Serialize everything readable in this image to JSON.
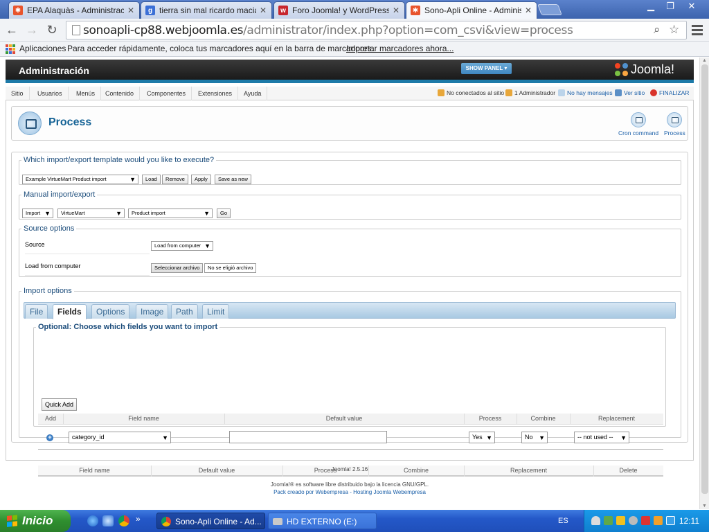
{
  "browser": {
    "tabs": [
      {
        "label": "EPA Alaquàs - Administración",
        "favicon": "joomla-icon",
        "active": false
      },
      {
        "label": "tierra sin mal ricardo macian",
        "favicon": "google-icon",
        "active": false
      },
      {
        "label": "Foro Joomla! y WordPress :: ",
        "favicon": "webempresa-icon",
        "active": false
      },
      {
        "label": "Sono-Apli Online - Administra",
        "favicon": "joomla-icon",
        "active": true
      }
    ],
    "tab_close_glyph": "✕",
    "url_host": "sonoapli-cp88.webjoomla.es",
    "url_path": "/administrator/index.php?option=com_csvi&view=process",
    "bookmarks": {
      "apps_label": "Aplicaciones",
      "hint": "Para acceder rápidamente, coloca tus marcadores aquí en la barra de marcadores.",
      "import_link": "Importar marcadores ahora..."
    }
  },
  "admin": {
    "header_title": "Administración",
    "show_panel": "SHOW PANEL",
    "logo_text": "Joomla!",
    "menu": [
      "Sitio",
      "Usuarios",
      "Menús",
      "Contenido",
      "Componentes",
      "Extensiones",
      "Ayuda"
    ],
    "status": {
      "visitors": "No conectados al sitio",
      "admins": "1 Administrador",
      "messages": "No hay mensajes",
      "view_site": "Ver sitio",
      "logout": "FINALIZAR"
    },
    "page_title": "Process",
    "toolbar": {
      "cron": "Cron command",
      "process": "Process"
    }
  },
  "template_section": {
    "legend": "Which import/export template would you like to execute?",
    "selected_template": "Example VirtueMart Product import",
    "buttons": {
      "load": "Load",
      "remove": "Remove",
      "apply": "Apply",
      "save_as_new": "Save as new"
    }
  },
  "manual_section": {
    "legend": "Manual import/export",
    "action": "Import",
    "component": "VirtueMart",
    "operation": "Product import",
    "go": "Go"
  },
  "source_section": {
    "legend": "Source options",
    "source_label": "Source",
    "source_value": "Load from computer",
    "file_label": "Load from computer",
    "file_button": "Seleccionar archivo",
    "file_status": "No se eligió archivo"
  },
  "import_section": {
    "legend": "Import options",
    "tabs": [
      "File",
      "Fields",
      "Options",
      "Image",
      "Path",
      "Limit"
    ],
    "active_tab": "Fields",
    "fields_legend": "Optional: Choose which fields you want to import",
    "quick_add": "Quick Add",
    "grid_headers": [
      "Add",
      "Field name",
      "Default value",
      "Process",
      "Combine",
      "Replacement"
    ],
    "row": {
      "field_name": "category_id",
      "default_value": "",
      "process": "Yes",
      "combine": "No",
      "replacement": "-- not used --"
    },
    "list_headers": [
      "Field name",
      "Default value",
      "Process",
      "Combine",
      "Replacement",
      "Delete"
    ]
  },
  "footer": {
    "version": "Joomla! 2.5.16",
    "license": "Joomla!® es software libre distribuido bajo la licencia GNU/GPL.",
    "credits": "Pack creado por Webempresa - Hosting Joomla Webempresa"
  },
  "taskbar": {
    "start": "Inicio",
    "items": [
      {
        "label": "Sono-Apli Online - Ad...",
        "icon": "chrome-icon",
        "active": true
      },
      {
        "label": "HD EXTERNO (E:)",
        "icon": "drive-icon",
        "active": false
      }
    ],
    "language": "ES",
    "clock": "12:11"
  },
  "colors": {
    "joomla_blue": "#146295",
    "header_dark": "#1a1a1a",
    "accent_bar": "#1d7aa8",
    "taskbar_blue": "#2458c8",
    "start_green": "#2f8f2f"
  }
}
